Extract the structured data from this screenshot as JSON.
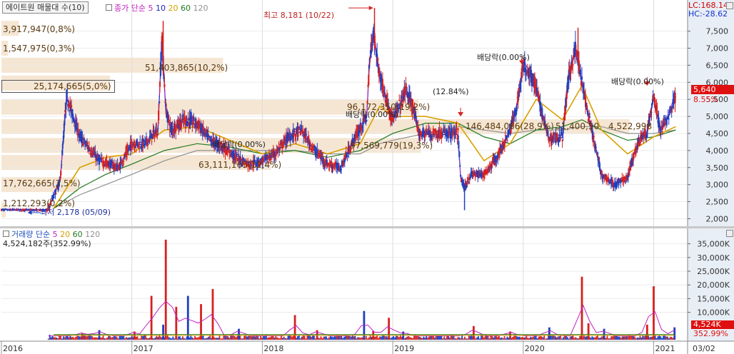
{
  "header": {
    "title_button": "에이트원 매물대 수(10)",
    "ma_label": "종가 단순",
    "ma_periods": [
      "5",
      "10",
      "20",
      "60",
      "120"
    ],
    "lc_readout": "LC:168.14",
    "hc_readout": "HC:-28.62"
  },
  "volume_header": {
    "label": "거래량 단순",
    "ma_periods": [
      "5",
      "20",
      "60",
      "120"
    ],
    "current": "4,524,182주(352.99%)"
  },
  "colors": {
    "up": "#d62020",
    "down": "#1f3fbf",
    "ma5": "#c020c0",
    "ma10": "#2020c0",
    "ma20": "#d8a000",
    "ma60": "#207a20",
    "ma120": "#909090",
    "profile": "#f5e6d3",
    "annotation": "#6a4a18"
  },
  "chart_data": [
    {
      "type": "candlestick",
      "title": "에이트원 매물대 수(10)",
      "x_ticks": [
        "2016",
        "2017",
        "2018",
        "2019",
        "2020",
        "2021",
        "03/02"
      ],
      "y_ticks": [
        "2,000",
        "2,500",
        "3,000",
        "3,500",
        "4,000",
        "4,500",
        "5,000",
        "5,500",
        "6,000",
        "6,500",
        "7,000",
        "7,500"
      ],
      "ylim": [
        1800,
        8350
      ],
      "current_price": "5,640",
      "current_change": "8.55%",
      "high_note": "최고 8,181 (10/22)",
      "low_note": "최저 2,178 (05/09)",
      "high": 8181,
      "low": 2178,
      "annotations": [
        {
          "text": "배당락(0.00%)",
          "price": 6680
        },
        {
          "text": "배당락(0.00%)",
          "price": 6060
        },
        {
          "text": "배당락(0.00%)",
          "price": 4920
        },
        {
          "text": "배당락(0.00%)",
          "price": 4190
        },
        {
          "text": "(12.84%)",
          "price": 5640
        }
      ],
      "volume_profile": [
        {
          "label": "1,212,293(0,2%)",
          "price": 2260,
          "share": 0.2
        },
        {
          "label": "17,762,665(3,5%)",
          "price": 3000,
          "share": 3.5
        },
        {
          "label": "63,111,165(12,4%)",
          "price": 3650,
          "share": 12.4
        },
        {
          "label": "97,569,779(19,3%)",
          "price": 4150,
          "share": 19.3
        },
        {
          "label": "146,484,086(28,9%)",
          "price": 4700,
          "share": 28.9
        },
        {
          "label": "51,400,50",
          "price": 4700,
          "share": 10.1
        },
        {
          "label": "96,172,350(19,2%)",
          "price": 5270,
          "share": 19.2
        },
        {
          "label": "25,174,665(5,0%)",
          "price": 5980,
          "share": 5.0
        },
        {
          "label": "51,403,865(10,2%)",
          "price": 6500,
          "share": 10.2
        },
        {
          "label": "1,547,975(0,3%)",
          "price": 7000,
          "share": 0.3
        },
        {
          "label": "3,917,947(0,8%)",
          "price": 7580,
          "share": 0.8
        },
        {
          "label": "4,522,998",
          "price": 4700,
          "share": 8.9
        }
      ],
      "price_series": {
        "dates": [
          2016.0,
          2016.35,
          2016.36,
          2016.45,
          2016.5,
          2016.6,
          2016.75,
          2016.9,
          2017.0,
          2017.1,
          2017.2,
          2017.23,
          2017.26,
          2017.3,
          2017.4,
          2017.5,
          2017.6,
          2017.7,
          2017.8,
          2017.9,
          2018.0,
          2018.1,
          2018.2,
          2018.3,
          2018.4,
          2018.5,
          2018.6,
          2018.7,
          2018.8,
          2018.82,
          2018.85,
          2018.9,
          2018.95,
          2019.0,
          2019.05,
          2019.1,
          2019.15,
          2019.2,
          2019.3,
          2019.4,
          2019.5,
          2019.52,
          2019.55,
          2019.6,
          2019.7,
          2019.8,
          2019.9,
          2019.95,
          2020.0,
          2020.05,
          2020.1,
          2020.15,
          2020.2,
          2020.25,
          2020.3,
          2020.35,
          2020.4,
          2020.45,
          2020.5,
          2020.6,
          2020.7,
          2020.8,
          2020.85,
          2020.9,
          2020.95,
          2021.0,
          2021.05,
          2021.1,
          2021.17
        ],
        "close": [
          2260,
          2250,
          2300,
          3100,
          5600,
          4400,
          3700,
          3500,
          4200,
          4200,
          4600,
          7300,
          5200,
          4600,
          4900,
          4800,
          4300,
          4100,
          3800,
          3600,
          3700,
          3900,
          4400,
          4600,
          4000,
          3600,
          3500,
          4300,
          5000,
          6500,
          7500,
          6200,
          5500,
          4900,
          5300,
          5800,
          5300,
          4500,
          4500,
          4500,
          4500,
          3200,
          2900,
          3300,
          3300,
          3800,
          4600,
          5300,
          6500,
          6300,
          5800,
          5000,
          4300,
          4400,
          4400,
          6200,
          7000,
          6000,
          5000,
          3300,
          3000,
          3200,
          3900,
          4400,
          4500,
          5600,
          4600,
          4900,
          5640
        ]
      },
      "ma_series": {
        "dates": [
          2016.4,
          2016.6,
          2016.8,
          2017.0,
          2017.25,
          2017.5,
          2017.75,
          2018.0,
          2018.25,
          2018.5,
          2018.75,
          2018.9,
          2019.0,
          2019.25,
          2019.5,
          2019.7,
          2019.9,
          2020.1,
          2020.3,
          2020.45,
          2020.6,
          2020.8,
          2021.0,
          2021.17
        ],
        "ma20": [
          2300,
          3500,
          3800,
          3900,
          4600,
          4700,
          4300,
          3900,
          4200,
          3900,
          4200,
          5300,
          5000,
          5000,
          4800,
          3700,
          4200,
          5500,
          4900,
          5900,
          4600,
          3900,
          4400,
          4700
        ],
        "ma60": [
          2300,
          2900,
          3300,
          3600,
          4000,
          4200,
          4100,
          3900,
          4000,
          3800,
          4000,
          4300,
          4500,
          4800,
          4800,
          4400,
          4200,
          4600,
          4700,
          4900,
          4600,
          4300,
          4400,
          4600
        ],
        "ma120": [
          2300,
          2700,
          3000,
          3300,
          3700,
          4000,
          4000,
          4000,
          4000,
          3900,
          3900,
          4200,
          4300,
          4500,
          4700,
          4600,
          4500,
          4600,
          4600,
          4700,
          4700,
          4500,
          4500,
          4600
        ]
      }
    },
    {
      "type": "bar",
      "title": "거래량",
      "y_ticks": [
        "10,000K",
        "15,000K",
        "20,000K",
        "25,000K",
        "30,000K",
        "35,000K"
      ],
      "ylim": [
        0,
        37500
      ],
      "current_value": "4,524K",
      "current_ratio": "352.99%",
      "spikes": {
        "dates": [
          2016.62,
          2016.75,
          2017.02,
          2017.15,
          2017.24,
          2017.26,
          2017.34,
          2017.43,
          2017.53,
          2017.62,
          2017.82,
          2018.25,
          2018.42,
          2018.78,
          2018.85,
          2018.97,
          2019.08,
          2019.62,
          2019.9,
          2020.2,
          2020.45,
          2020.5,
          2020.62,
          2020.95,
          2021.0,
          2021.16
        ],
        "values": [
          2500,
          3500,
          3000,
          16000,
          5500,
          36500,
          12000,
          16000,
          13000,
          18500,
          4000,
          9000,
          3500,
          10500,
          3200,
          8000,
          3000,
          5000,
          3000,
          4500,
          23000,
          6000,
          4000,
          5500,
          19500,
          4524
        ]
      }
    }
  ]
}
